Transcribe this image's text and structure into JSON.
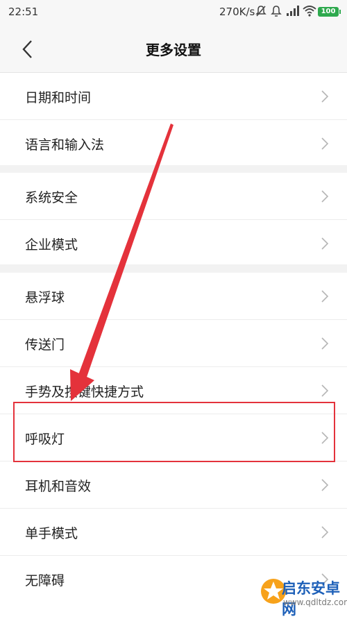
{
  "status_bar": {
    "time": "22:51",
    "speed": "270K/s",
    "battery": "100",
    "icons": [
      "mute-icon",
      "alarm-icon",
      "signal-icon",
      "wifi-icon",
      "battery-icon"
    ]
  },
  "header": {
    "title": "更多设置",
    "back_icon": "chevron-left-icon"
  },
  "groups": [
    {
      "items": [
        "日期和时间",
        "语言和输入法"
      ]
    },
    {
      "items": [
        "系统安全",
        "企业模式"
      ]
    },
    {
      "items": [
        "悬浮球",
        "传送门",
        "手势及按键快捷方式",
        "呼吸灯",
        "耳机和音效",
        "单手模式",
        "无障碍"
      ]
    }
  ],
  "annotation": {
    "highlighted_item": "呼吸灯",
    "color": "#e4323b"
  },
  "watermark": {
    "name": "启东安卓网",
    "url": "www.qdltdz.com"
  }
}
